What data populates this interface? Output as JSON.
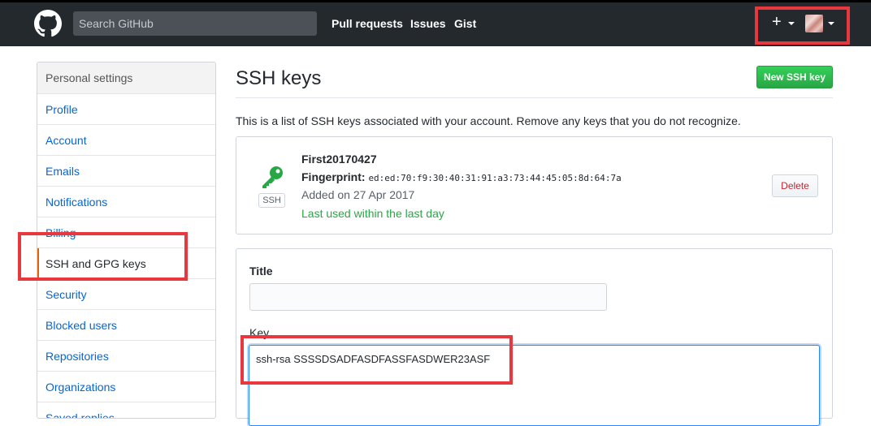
{
  "header": {
    "search_placeholder": "Search GitHub",
    "nav": [
      "Pull requests",
      "Issues",
      "Gist"
    ],
    "plus_icon": "+"
  },
  "sidebar": {
    "heading": "Personal settings",
    "items": [
      {
        "label": "Profile"
      },
      {
        "label": "Account"
      },
      {
        "label": "Emails"
      },
      {
        "label": "Notifications"
      },
      {
        "label": "Billing"
      },
      {
        "label": "SSH and GPG keys",
        "selected": true
      },
      {
        "label": "Security"
      },
      {
        "label": "Blocked users"
      },
      {
        "label": "Repositories"
      },
      {
        "label": "Organizations"
      },
      {
        "label": "Saved replies"
      }
    ]
  },
  "main": {
    "title": "SSH keys",
    "new_key_button": "New SSH key",
    "intro": "This is a list of SSH keys associated with your account. Remove any keys that you do not recognize.",
    "key": {
      "badge": "SSH",
      "name": "First20170427",
      "fingerprint_label": "Fingerprint:",
      "fingerprint": "ed:ed:70:f9:30:40:31:91:a3:73:44:45:05:8d:64:7a",
      "added": "Added on 27 Apr 2017",
      "last_used": "Last used within the last day",
      "delete_button": "Delete"
    },
    "form": {
      "title_label": "Title",
      "title_value": "",
      "key_label": "Key",
      "key_value": "ssh-rsa SSSSDSADFASDFASSFASDWER23ASF"
    }
  },
  "colors": {
    "header_bg": "#24292e",
    "link": "#0366d6",
    "green_button": "#28a745",
    "selected_accent": "#e36209",
    "annotation_red": "#e8383d"
  }
}
